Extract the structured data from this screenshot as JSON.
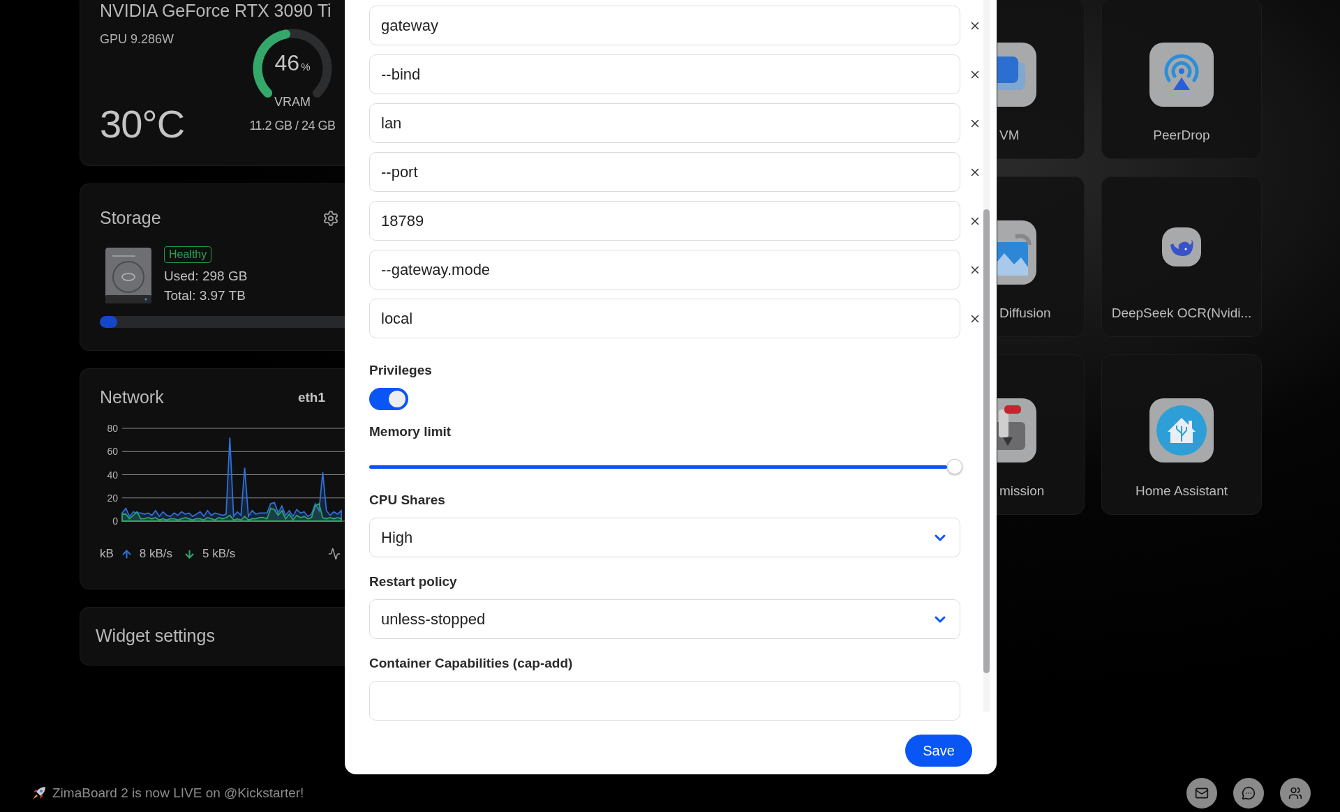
{
  "gpu": {
    "title": "NVIDIA GeForce RTX 3090 Ti",
    "power": "GPU 9.286W",
    "temperature": "30°C",
    "vram": {
      "percent": "46",
      "unit": "%",
      "label": "VRAM",
      "level": 0.46,
      "usage": "11.2 GB / 24 GB"
    }
  },
  "storage": {
    "title": "Storage",
    "status": "Healthy",
    "used": "Used: 298 GB",
    "total": "Total: 3.97 TB",
    "level": 0.07
  },
  "network": {
    "title": "Network",
    "interface": "eth1",
    "unit": "kB",
    "upload": "8 kB/s",
    "download": "5 kB/s",
    "chart_data": {
      "type": "area",
      "grid": true,
      "ylim": [
        0,
        80
      ],
      "yticks": [
        0,
        20,
        40,
        60,
        80
      ],
      "series": [
        {
          "color": "#2f6fd6",
          "values": [
            7,
            11,
            4,
            8,
            7,
            7,
            6,
            7,
            5,
            9,
            4,
            8,
            5,
            4,
            7,
            5,
            8,
            6,
            7,
            4,
            6,
            8,
            4,
            9,
            5,
            7,
            6,
            5,
            6,
            72,
            4,
            8,
            5,
            46,
            4,
            9,
            6,
            7,
            7,
            7,
            15,
            16,
            7,
            13,
            5,
            9,
            4,
            10,
            7,
            8,
            4,
            6,
            15,
            9,
            42,
            9,
            5,
            8,
            6,
            9
          ]
        },
        {
          "color": "#2fa36b",
          "values": [
            6,
            6,
            2,
            5,
            8,
            2,
            2,
            3,
            2,
            3,
            1,
            2,
            1,
            2,
            2,
            1,
            2,
            3,
            2,
            1,
            2,
            2,
            1,
            3,
            2,
            1,
            3,
            2,
            3,
            5,
            1,
            2,
            1,
            4,
            1,
            2,
            2,
            3,
            3,
            2,
            11,
            10,
            5,
            9,
            2,
            6,
            1,
            5,
            3,
            4,
            2,
            3,
            13,
            15,
            3,
            2,
            3,
            2,
            3,
            2
          ]
        }
      ]
    }
  },
  "widget_settings": {
    "title": "Widget settings"
  },
  "modal": {
    "arguments": [
      "gateway",
      "--bind",
      "lan",
      "--port",
      "18789",
      "--gateway.mode",
      "local"
    ],
    "privileges": {
      "label": "Privileges",
      "on": true
    },
    "memory_limit": {
      "label": "Memory limit",
      "level": 1
    },
    "cpu_shares": {
      "label": "CPU Shares",
      "value": "High"
    },
    "restart_policy": {
      "label": "Restart policy",
      "value": "unless-stopped"
    },
    "cap_add": {
      "label": "Container Capabilities (cap-add)"
    },
    "save": "Save"
  },
  "apps_cut_off": [
    {
      "name": "VM",
      "kind": "windows"
    },
    {
      "name": "Diffusion",
      "kind": "picture"
    },
    {
      "name": "mission",
      "kind": "tool"
    }
  ],
  "apps": [
    {
      "name": "PeerDrop",
      "kind": "broadcast"
    },
    {
      "name": "DeepSeek OCR(Nvidi...",
      "kind": "whale"
    },
    {
      "name": "Home Assistant",
      "kind": "home"
    }
  ],
  "banner": {
    "text": "ZimaBoard 2 is now LIVE on @Kickstarter!"
  },
  "dock": [
    {
      "kind": "mail"
    },
    {
      "kind": "chat"
    },
    {
      "kind": "users"
    }
  ]
}
